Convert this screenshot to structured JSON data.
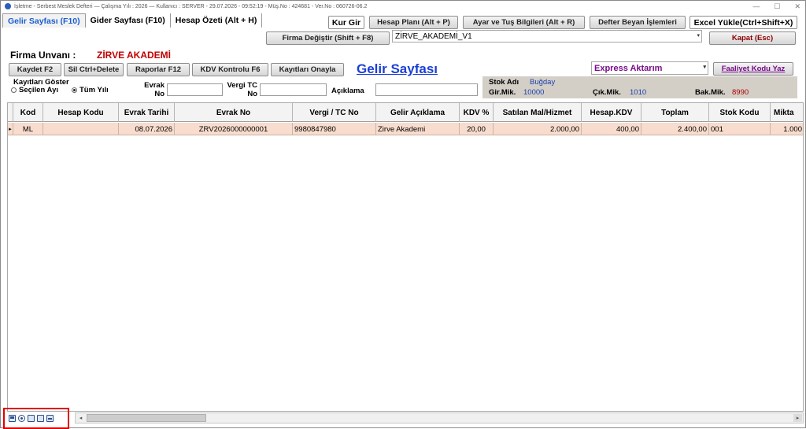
{
  "window": {
    "title": "İşletme - Serbest Meslek Defteri  —  Çalışma Yılı : 2026  —  Kullanıcı : SERVER - 29.07.2026 - 09:52:19 - Müş.No : 424681 - Ver.No : 060726-06.2"
  },
  "tabs": [
    {
      "label": "Gelir Sayfası (F10)",
      "active": true
    },
    {
      "label": "Gider Sayfası (F10)",
      "active": false
    },
    {
      "label": "Hesap Özeti (Alt + H)",
      "active": false
    }
  ],
  "toolbar_top": {
    "kur_gir": "Kur Gir",
    "hesap_plani": "Hesap Planı (Alt + P)",
    "ayar_tus": "Ayar ve Tuş Bilgileri (Alt + R)",
    "defter_beyan": "Defter Beyan İşlemleri",
    "excel_yukle": "Excel Yükle(Ctrl+Shift+X)",
    "firma_degistir": "Firma Değiştir (Shift + F8)",
    "firma_combo_value": "ZİRVE_AKADEMİ_V1",
    "kapat": "Kapat (Esc)"
  },
  "firma": {
    "label": "Firma Unvanı :",
    "value": "ZİRVE AKADEMİ"
  },
  "actions": {
    "kaydet": "Kaydet F2",
    "sil": "Sil Ctrl+Delete",
    "raporlar": "Raporlar F12",
    "kdv_kontrolu": "KDV Kontrolu F6",
    "kayitlari_onayla": "Kayıtları Onayla"
  },
  "page_title": "Gelir Sayfası",
  "express_combo": "Express Aktarım",
  "faaliyet_kodu_yaz": "Faaliyet Kodu Yaz",
  "filters": {
    "show_label": "Kayıtları Göster",
    "radio_selected_month": "Seçilen Ayı",
    "radio_all_year": "Tüm Yılı",
    "evrak_no_line1": "Evrak",
    "evrak_no_line2": "No",
    "vergi_tc_line1": "Vergi TC",
    "vergi_tc_line2": "No",
    "aciklama": "Açıklama"
  },
  "stock": {
    "stok_adi_label": "Stok Adı",
    "stok_adi_value": "Buğday",
    "gir_mik_label": "Gir.Mik.",
    "gir_mik_value": "10000",
    "cik_mik_label": "Çık.Mik.",
    "cik_mik_value": "1010",
    "bak_mik_label": "Bak.Mik.",
    "bak_mik_value": "8990"
  },
  "grid": {
    "columns": [
      "Kod",
      "Hesap Kodu",
      "Evrak Tarihi",
      "Evrak No",
      "Vergi / TC No",
      "Gelir Açıklama",
      "KDV %",
      "Satılan Mal/Hizmet",
      "Hesap.KDV",
      "Toplam",
      "Stok Kodu",
      "Mikta"
    ],
    "rows": [
      [
        "ML",
        "",
        "08.07.2026",
        "ZRV2026000000001",
        "9980847980",
        "Zirve Akademi",
        "20,00",
        "2.000,00",
        "400,00",
        "2.400,00",
        "001",
        "1.000"
      ]
    ]
  },
  "colors": {
    "tab_active": "#1a5fd0",
    "firma_value": "#c00000",
    "page_title": "#1a3fd6",
    "row_highlight": "#f8dccd",
    "highlight_box": "#e10000"
  }
}
